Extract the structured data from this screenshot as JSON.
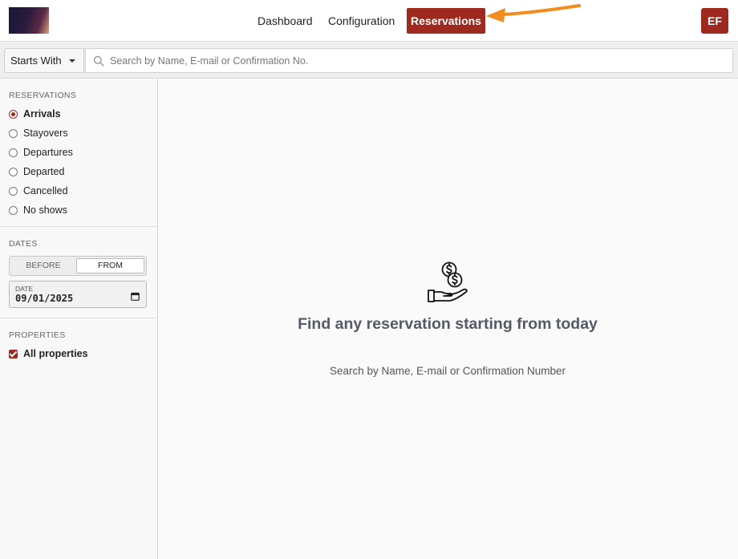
{
  "nav": {
    "items": [
      {
        "label": "Dashboard"
      },
      {
        "label": "Configuration"
      },
      {
        "label": "Reservations"
      }
    ],
    "avatar_initials": "EF",
    "accent_color": "#9e2a1f",
    "annotation_arrow_color": "#f28c1e"
  },
  "search": {
    "mode": "Starts With",
    "placeholder": "Search by Name, E-mail or Confirmation No.",
    "value": ""
  },
  "sidebar": {
    "reservations_title": "RESERVATIONS",
    "reservation_filters": [
      {
        "label": "Arrivals",
        "selected": true
      },
      {
        "label": "Stayovers",
        "selected": false
      },
      {
        "label": "Departures",
        "selected": false
      },
      {
        "label": "Departed",
        "selected": false
      },
      {
        "label": "Cancelled",
        "selected": false
      },
      {
        "label": "No shows",
        "selected": false
      }
    ],
    "dates_title": "DATES",
    "date_mode": {
      "before_label": "BEFORE",
      "from_label": "FROM",
      "selected": "FROM"
    },
    "date_field": {
      "label": "DATE",
      "value": "09/01/2025"
    },
    "properties_title": "PROPERTIES",
    "properties_checkbox": {
      "label": "All properties",
      "checked": true
    }
  },
  "main": {
    "empty_title": "Find any reservation starting from today",
    "empty_subtitle": "Search by Name, E-mail or Confirmation Number",
    "icon": "hand-with-coins-icon"
  }
}
